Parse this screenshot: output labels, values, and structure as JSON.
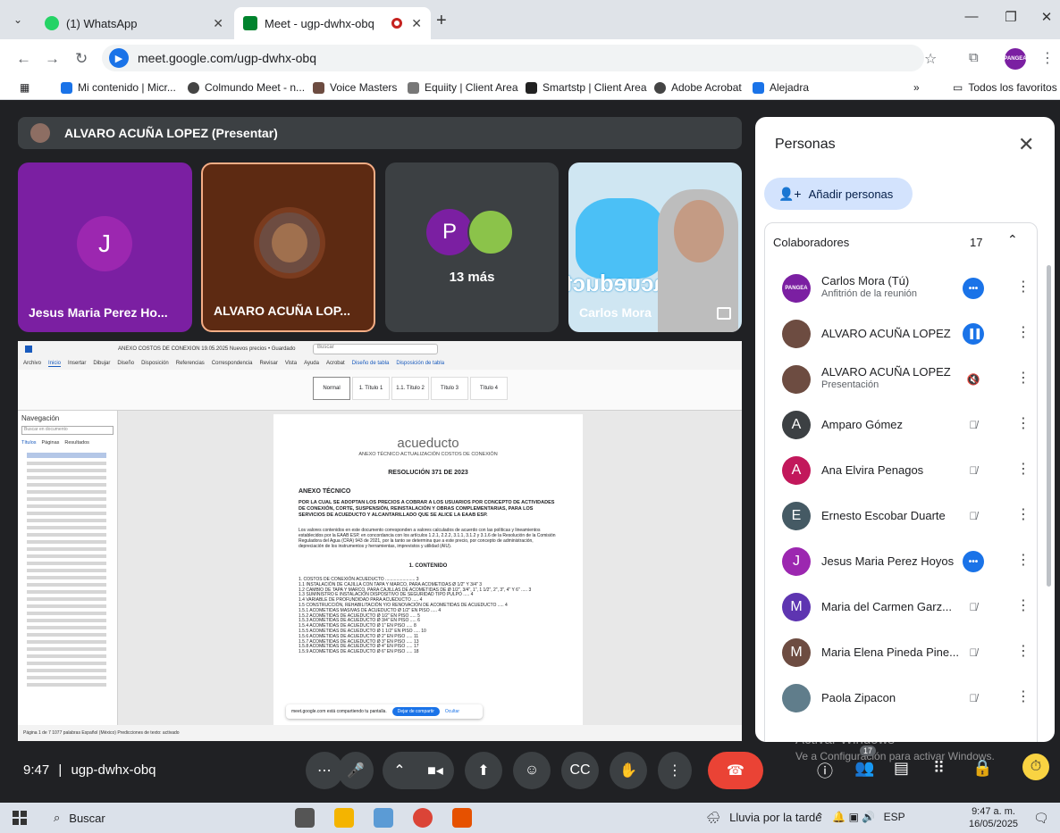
{
  "browser": {
    "tabs": [
      {
        "title": "(1) WhatsApp",
        "active": false,
        "icon": "whatsapp-icon",
        "icon_color": "#25d366"
      },
      {
        "title": "Meet - ugp-dwhx-obq",
        "active": true,
        "icon": "meet-icon",
        "icon_color": "#00832d",
        "recording": true
      }
    ],
    "url": "meet.google.com/ugp-dwhx-obq",
    "bookmarks": [
      {
        "label": "Mi contenido | Micr...",
        "color": "#1a73e8"
      },
      {
        "label": "Colmundo Meet - n...",
        "color": "#444444"
      },
      {
        "label": "Voice Masters",
        "color": "#444444"
      },
      {
        "label": "Equiity | Client Area",
        "color": "#444444"
      },
      {
        "label": "Smartstp | Client Area",
        "color": "#444444"
      },
      {
        "label": "Adobe Acrobat",
        "color": "#444444"
      },
      {
        "label": "Alejadra",
        "color": "#1a73e8"
      }
    ],
    "bookmarks_overflow": "»",
    "all_bookmarks": "Todos los favoritos",
    "profile_text": "PANGEA"
  },
  "meet": {
    "presenter_bar": "ALVARO ACUÑA LOPEZ (Presentar)",
    "tiles": [
      {
        "name": "Jesus Maria Perez Ho...",
        "avatar_letter": "J",
        "bg": "#7b1fa2"
      },
      {
        "name": "ALVARO ACUÑA LOP...",
        "bg": "#5d2a12"
      },
      {
        "label": "13 más",
        "avatar_letter": "P",
        "bg": "#3c4043"
      },
      {
        "name": "Carlos Mora",
        "logo_text": "acueducto",
        "bg": "#cfe6f2"
      }
    ],
    "meeting_time": "9:47",
    "meeting_code": "ugp-dwhx-obq",
    "people_badge": "17",
    "watermark_title": "Activar Windows",
    "watermark_sub": "Ve a Configuración para activar Windows."
  },
  "shared_doc": {
    "title_bar": "ANEXO COSTOS DE CONEXION 19.05.2025 Nuevos precios • Guardado",
    "search": "Buscar",
    "menu": [
      "Archivo",
      "Inicio",
      "Insertar",
      "Dibujar",
      "Diseño",
      "Disposición",
      "Referencias",
      "Correspondencia",
      "Revisar",
      "Vista",
      "Ayuda",
      "Acrobat",
      "Diseño de tabla",
      "Disposición de tabla"
    ],
    "styles": [
      "Normal",
      "1. Título 1",
      "1.1. Título 2",
      "Título 3",
      "Título 4"
    ],
    "nav_title": "Navegación",
    "nav_search": "Buscar en documento",
    "nav_tabs": [
      "Títulos",
      "Páginas",
      "Resultados"
    ],
    "logo": "acueducto",
    "logo_sub": "ANEXO TÉCNICO ACTUALIZACIÓN COSTOS DE CONEXIÓN",
    "resolution": "RESOLUCIÓN 371 DE 2023",
    "heading": "ANEXO TÉCNICO",
    "intro": "POR LA CUAL SE ADOPTAN LOS PRECIOS A COBRAR A LOS USUARIOS POR CONCEPTO DE ACTIVIDADES DE CONEXIÓN, CORTE, SUSPENSIÓN, REINSTALACIÓN Y OBRAS COMPLEMENTARIAS, PARA LOS SERVICIOS DE ACUEDUCTO Y ALCANTARILLADO QUE SE ALICE LA EAAB ESP.",
    "body": "Los valores contenidos en este documento corresponden a valores calculados de acuerdo con las políticas y lineamientos establecidos por la EAAB ESP, en concordancia con los artículos 1.2.1, 2.2.2, 3.1.1, 3.1.2 y 3.1.6 de la Resolución de la Comisión Reguladora del Agua (CRA) 943 de 2021, por la tanto se determina que a este precio, por concepto de administración, depreciación de los instrumentos y herramientas, imprevistos y utilidad (AIU).",
    "contents_heading": "1. CONTENIDO",
    "toc": [
      "1. COSTOS DE CONEXIÓN ACUEDUCTO ........................ 3",
      "1.1 INSTALACIÓN DE CAJILLA CON TAPA Y MARCO, PARA ACOMETIDAS Ø 1/2\" Y 3/4\" 3",
      "1.2 CAMBIO DE TAPA Y MARCO, PARA CAJILLAS DE ACOMETIDAS DE Ø 1/2\", 3/4\", 1\", 1 1/2\", 2\", 3\", 4\" Y 6\" ..... 3",
      "1.3 SUMINISTRO E INSTALACIÓN DISPOSITIVO DE SEGURIDAD TIPO PULPO ..... 4",
      "1.4 VARIABLE DE PROFUNDIDAD PARA ACUEDUCTO ..... 4",
      "1.5 CONSTRUCCIÓN, REHABILITACIÓN Y/O RENOVACIÓN DE ACOMETIDAS DE ACUEDUCTO ..... 4",
      "1.5.1 ACOMETIDAS MASIVAS DE ACUEDUCTO Ø 1/2\" EN PISO ..... 4",
      "1.5.2 ACOMETIDAS DE ACUEDUCTO Ø 1/2\" EN PISO ..... 5",
      "1.5.3 ACOMETIDAS DE ACUEDUCTO Ø 3/4\" EN PISO ..... 6",
      "1.5.4 ACOMETIDAS DE ACUEDUCTO Ø 1\" EN PISO ..... 8",
      "1.5.5 ACOMETIDAS DE ACUEDUCTO Ø 1 1/2\" EN PISO ..... 10",
      "1.5.6 ACOMETIDAS DE ACUEDUCTO Ø 2\" EN PISO ..... 11",
      "1.5.7 ACOMETIDAS DE ACUEDUCTO Ø 3\" EN PISO ..... 13",
      "1.5.8 ACOMETIDAS DE ACUEDUCTO Ø 4\" EN PISO ..... 17",
      "1.5.9 ACOMETIDAS DE ACUEDUCTO Ø 6\" EN PISO ..... 18"
    ],
    "share_msg": "meet.google.com está compartiendo tu pantalla.",
    "stop_share": "Dejar de compartir",
    "hide": "Ocultar",
    "status": "Página 1 de 7   1077 palabras   Español (México)   Predicciones de texto: activado"
  },
  "people_panel": {
    "title": "Personas",
    "add_label": "Añadir personas",
    "section": "Colaboradores",
    "count": "17",
    "people": [
      {
        "name": "Carlos Mora (Tú)",
        "sub": "Anfitrión de la reunión",
        "avatar": "PANGEA",
        "color": "#7b1fa2",
        "status": "more-dots"
      },
      {
        "name": "ALVARO ACUÑA LOPEZ",
        "sub": "",
        "avatar": "",
        "color": "#6d4c41",
        "status": "speaking"
      },
      {
        "name": "ALVARO ACUÑA LOPEZ",
        "sub": "Presentación",
        "avatar": "",
        "color": "#6d4c41",
        "status": "muted-sound"
      },
      {
        "name": "Amparo Gómez",
        "sub": "",
        "avatar": "A",
        "color": "#3c4043",
        "status": "mic-off"
      },
      {
        "name": "Ana Elvira Penagos",
        "sub": "",
        "avatar": "A",
        "color": "#c2185b",
        "status": "mic-off"
      },
      {
        "name": "Ernesto Escobar Duarte",
        "sub": "",
        "avatar": "E",
        "color": "#455a64",
        "status": "mic-off"
      },
      {
        "name": "Jesus Maria Perez Hoyos",
        "sub": "",
        "avatar": "J",
        "color": "#9c27b0",
        "status": "more-dots"
      },
      {
        "name": "Maria del Carmen Garz...",
        "sub": "",
        "avatar": "M",
        "color": "#5e35b1",
        "status": "mic-off"
      },
      {
        "name": "Maria Elena Pineda Pine...",
        "sub": "",
        "avatar": "M",
        "color": "#6d4c41",
        "status": "mic-off"
      },
      {
        "name": "Paola Zipacon",
        "sub": "",
        "avatar": "",
        "color": "#607d8b",
        "status": "mic-off"
      }
    ]
  },
  "taskbar": {
    "search": "Buscar",
    "weather": "Lluvia por la tarde",
    "lang": "ESP",
    "time": "9:47 a. m.",
    "date": "16/05/2025"
  }
}
